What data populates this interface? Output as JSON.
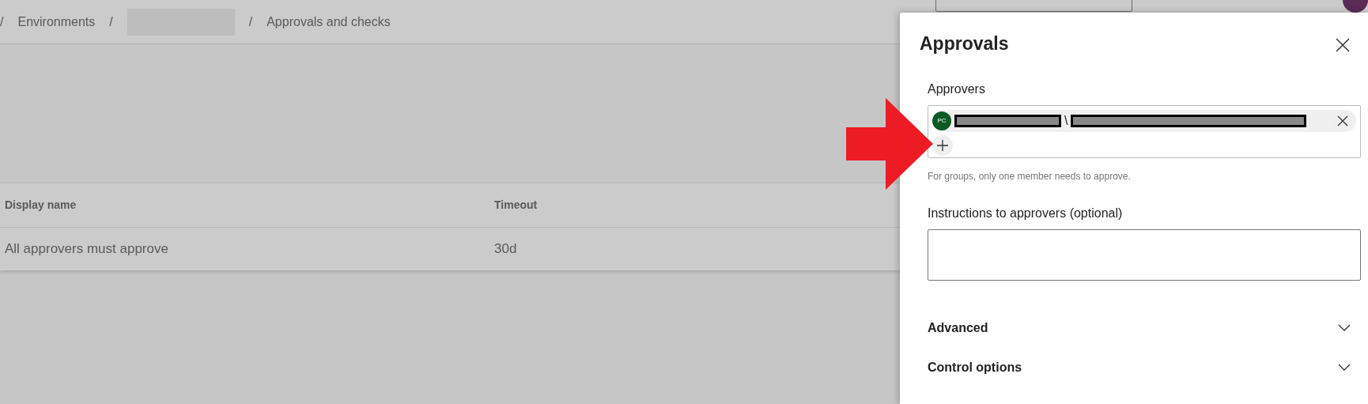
{
  "breadcrumb": {
    "separator": "/",
    "items": [
      {
        "kind": "link",
        "label": "Environments"
      },
      {
        "kind": "redacted"
      },
      {
        "kind": "text",
        "label": "Approvals and checks"
      }
    ]
  },
  "table": {
    "columns": [
      "Display name",
      "Timeout"
    ],
    "rows": [
      [
        "All approvers must approve",
        "30d"
      ]
    ]
  },
  "panel": {
    "title": "Approvals",
    "approvers_label": "Approvers",
    "approvers": [
      {
        "initials": "PC",
        "separator": "\\"
      }
    ],
    "helper": "For groups, only one member needs to approve.",
    "instructions_label": "Instructions to approvers (optional)",
    "sections": [
      {
        "label": "Advanced",
        "expanded": false
      },
      {
        "label": "Control options",
        "expanded": false
      }
    ]
  }
}
